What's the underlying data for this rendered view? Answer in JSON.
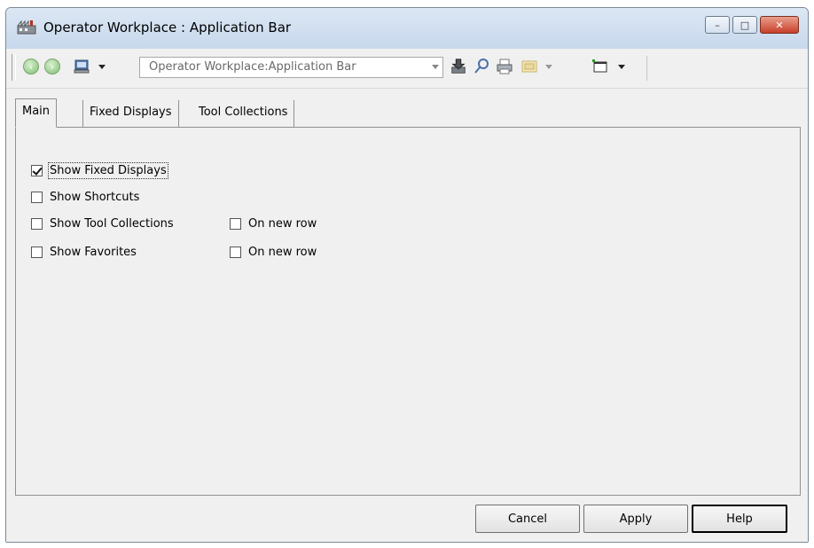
{
  "window": {
    "title": "Operator Workplace : Application Bar",
    "controls": {
      "minimize": "–",
      "maximize": "□",
      "close": "✕"
    }
  },
  "toolbar": {
    "address_value": "Operator Workplace:Application Bar"
  },
  "tabs": [
    {
      "label": "Main",
      "active": true
    },
    {
      "label": "Fixed Displays",
      "active": false
    },
    {
      "label": "Tool Collections",
      "active": false
    }
  ],
  "main_tab": {
    "show_fixed_displays": {
      "label": "Show Fixed Displays",
      "checked": true
    },
    "show_shortcuts": {
      "label": "Show Shortcuts",
      "checked": false
    },
    "show_tool_collections": {
      "label": "Show Tool Collections",
      "checked": false
    },
    "tool_collections_new_row": {
      "label": "On new row",
      "checked": false
    },
    "show_favorites": {
      "label": "Show Favorites",
      "checked": false
    },
    "favorites_new_row": {
      "label": "On new row",
      "checked": false
    }
  },
  "buttons": {
    "cancel": "Cancel",
    "apply": "Apply",
    "help": "Help"
  },
  "colors": {
    "titlebar": "#c7d8ec",
    "close_button": "#c8402a",
    "dialog_background": "#f0f0f0"
  }
}
